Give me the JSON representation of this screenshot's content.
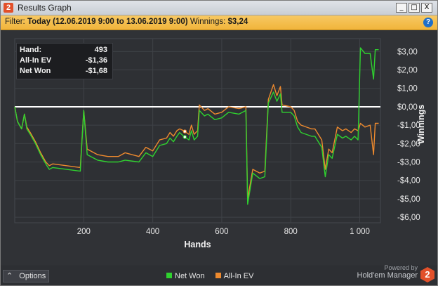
{
  "window": {
    "app_icon": "2",
    "title": "Results Graph",
    "controls": {
      "minimize": "_",
      "maximize": "□",
      "close": "X"
    }
  },
  "filter": {
    "label": "Filter:",
    "value": "Today (12.06.2019 9:00 to 13.06.2019 9:00)",
    "winnings_label": "Winnings:",
    "winnings_value": "$3,24",
    "help_icon": "?"
  },
  "info_box": {
    "rows": [
      {
        "label": "Hand:",
        "value": "493"
      },
      {
        "label": "All-In EV",
        "value": "-$1,36"
      },
      {
        "label": "Net Won",
        "value": "-$1,68"
      }
    ]
  },
  "bottom": {
    "options_label": "Options",
    "legend": [
      {
        "label": "Net Won",
        "color": "#2fd22f"
      },
      {
        "label": "All-In EV",
        "color": "#ee8a2e"
      }
    ],
    "powered_by": "Powered by",
    "brand": "Hold'em Manager",
    "brand_icon": "2"
  },
  "colors": {
    "net_won": "#2fd22f",
    "all_in_ev": "#ee8a2e",
    "zero_line": "#ffffff",
    "filter_bar": "#f1b53b"
  },
  "chart_data": {
    "type": "line",
    "xlabel": "Hands",
    "ylabel": "Winnings",
    "xlim": [
      0,
      1060
    ],
    "ylim": [
      -6.3,
      3.7
    ],
    "x_ticks": [
      200,
      400,
      600,
      800,
      1000
    ],
    "x_tick_labels": [
      "200",
      "400",
      "600",
      "800",
      "1 000"
    ],
    "y_ticks": [
      3,
      2,
      1,
      0,
      -1,
      -2,
      -3,
      -4,
      -5,
      -6
    ],
    "y_tick_labels": [
      "$3,00",
      "$2,00",
      "$1,00",
      "$0,00",
      "-$1,00",
      "-$2,00",
      "-$3,00",
      "-$4,00",
      "-$5,00",
      "-$6,00"
    ],
    "grid": true,
    "series": [
      {
        "name": "Net Won",
        "color": "#2fd22f",
        "points": [
          [
            0,
            0
          ],
          [
            8,
            -0.8
          ],
          [
            20,
            -1.2
          ],
          [
            28,
            -0.4
          ],
          [
            35,
            -1.2
          ],
          [
            45,
            -1.5
          ],
          [
            60,
            -2.0
          ],
          [
            75,
            -2.6
          ],
          [
            90,
            -3.1
          ],
          [
            100,
            -3.4
          ],
          [
            110,
            -3.3
          ],
          [
            190,
            -3.5
          ],
          [
            200,
            -0.2
          ],
          [
            210,
            -2.6
          ],
          [
            240,
            -2.9
          ],
          [
            270,
            -3.0
          ],
          [
            300,
            -3.0
          ],
          [
            320,
            -2.9
          ],
          [
            360,
            -3.0
          ],
          [
            380,
            -2.5
          ],
          [
            400,
            -2.7
          ],
          [
            420,
            -2.1
          ],
          [
            440,
            -2.0
          ],
          [
            450,
            -1.7
          ],
          [
            460,
            -1.9
          ],
          [
            470,
            -1.6
          ],
          [
            478,
            -1.4
          ],
          [
            490,
            -1.6
          ],
          [
            505,
            -1.8
          ],
          [
            512,
            -1.3
          ],
          [
            520,
            -1.8
          ],
          [
            530,
            -1.6
          ],
          [
            535,
            -0.2
          ],
          [
            550,
            -0.5
          ],
          [
            560,
            -0.4
          ],
          [
            580,
            -0.7
          ],
          [
            600,
            -0.6
          ],
          [
            620,
            -0.3
          ],
          [
            650,
            -0.4
          ],
          [
            670,
            -0.2
          ],
          [
            675,
            -5.3
          ],
          [
            690,
            -3.6
          ],
          [
            710,
            -3.9
          ],
          [
            725,
            -3.8
          ],
          [
            735,
            0.2
          ],
          [
            750,
            0.8
          ],
          [
            760,
            0.3
          ],
          [
            770,
            0.7
          ],
          [
            775,
            -0.3
          ],
          [
            800,
            -0.3
          ],
          [
            810,
            -0.5
          ],
          [
            820,
            -1.1
          ],
          [
            830,
            -1.4
          ],
          [
            860,
            -1.6
          ],
          [
            870,
            -1.6
          ],
          [
            890,
            -2.2
          ],
          [
            900,
            -3.8
          ],
          [
            910,
            -2.6
          ],
          [
            920,
            -2.8
          ],
          [
            935,
            -1.5
          ],
          [
            950,
            -1.7
          ],
          [
            960,
            -1.6
          ],
          [
            975,
            -1.8
          ],
          [
            985,
            -1.6
          ],
          [
            995,
            -1.8
          ],
          [
            1002,
            3.2
          ],
          [
            1015,
            2.9
          ],
          [
            1030,
            2.9
          ],
          [
            1040,
            1.5
          ],
          [
            1045,
            3.1
          ],
          [
            1055,
            3.1
          ]
        ]
      },
      {
        "name": "All-In EV",
        "color": "#ee8a2e",
        "points": [
          [
            0,
            0
          ],
          [
            8,
            -0.8
          ],
          [
            20,
            -1.2
          ],
          [
            28,
            -0.4
          ],
          [
            35,
            -1.1
          ],
          [
            45,
            -1.4
          ],
          [
            60,
            -1.9
          ],
          [
            75,
            -2.5
          ],
          [
            90,
            -3.0
          ],
          [
            100,
            -3.2
          ],
          [
            110,
            -3.1
          ],
          [
            190,
            -3.3
          ],
          [
            200,
            -0.2
          ],
          [
            210,
            -2.3
          ],
          [
            240,
            -2.6
          ],
          [
            270,
            -2.7
          ],
          [
            300,
            -2.7
          ],
          [
            320,
            -2.5
          ],
          [
            360,
            -2.7
          ],
          [
            380,
            -2.2
          ],
          [
            400,
            -2.4
          ],
          [
            420,
            -1.8
          ],
          [
            440,
            -1.7
          ],
          [
            450,
            -1.4
          ],
          [
            460,
            -1.6
          ],
          [
            470,
            -1.3
          ],
          [
            478,
            -1.2
          ],
          [
            490,
            -1.3
          ],
          [
            505,
            -1.5
          ],
          [
            512,
            -1.0
          ],
          [
            520,
            -1.5
          ],
          [
            530,
            -1.3
          ],
          [
            535,
            0.1
          ],
          [
            550,
            -0.2
          ],
          [
            560,
            -0.1
          ],
          [
            580,
            -0.4
          ],
          [
            600,
            -0.3
          ],
          [
            620,
            0.0
          ],
          [
            650,
            -0.1
          ],
          [
            670,
            0.0
          ],
          [
            675,
            -5.0
          ],
          [
            690,
            -3.4
          ],
          [
            710,
            -3.6
          ],
          [
            725,
            -3.5
          ],
          [
            735,
            0.4
          ],
          [
            750,
            1.2
          ],
          [
            760,
            0.6
          ],
          [
            770,
            1.1
          ],
          [
            775,
            0.1
          ],
          [
            800,
            0.0
          ],
          [
            810,
            -0.2
          ],
          [
            820,
            -0.8
          ],
          [
            830,
            -1.0
          ],
          [
            860,
            -1.2
          ],
          [
            870,
            -1.2
          ],
          [
            890,
            -1.8
          ],
          [
            900,
            -3.4
          ],
          [
            910,
            -2.3
          ],
          [
            920,
            -2.5
          ],
          [
            935,
            -1.1
          ],
          [
            950,
            -1.3
          ],
          [
            960,
            -1.2
          ],
          [
            975,
            -1.4
          ],
          [
            985,
            -1.2
          ],
          [
            995,
            -1.3
          ],
          [
            1002,
            -0.9
          ],
          [
            1015,
            -1.1
          ],
          [
            1030,
            -1.0
          ],
          [
            1040,
            -2.6
          ],
          [
            1045,
            -0.9
          ],
          [
            1055,
            -0.9
          ]
        ]
      }
    ],
    "highlight_hand": 493
  }
}
